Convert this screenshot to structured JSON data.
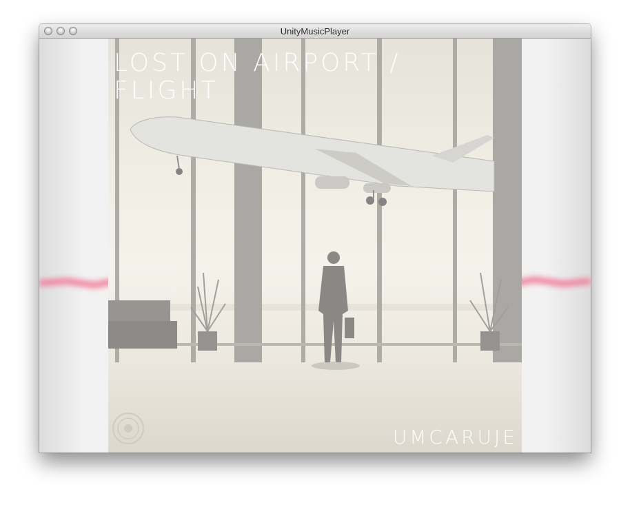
{
  "window": {
    "title": "UnityMusicPlayer"
  },
  "album": {
    "title_line1": "Lost on Airport /",
    "title_line2": "Flight",
    "artist": "UMCARUJE",
    "cover_icons": [
      "airplane-icon",
      "silhouette-man-icon",
      "plant-icon",
      "sofa-icon",
      "emblem-icon"
    ]
  },
  "colors": {
    "visualizer": "#f07a98",
    "titlebar": "#d8d8d8",
    "background": "#f2f2f2"
  }
}
